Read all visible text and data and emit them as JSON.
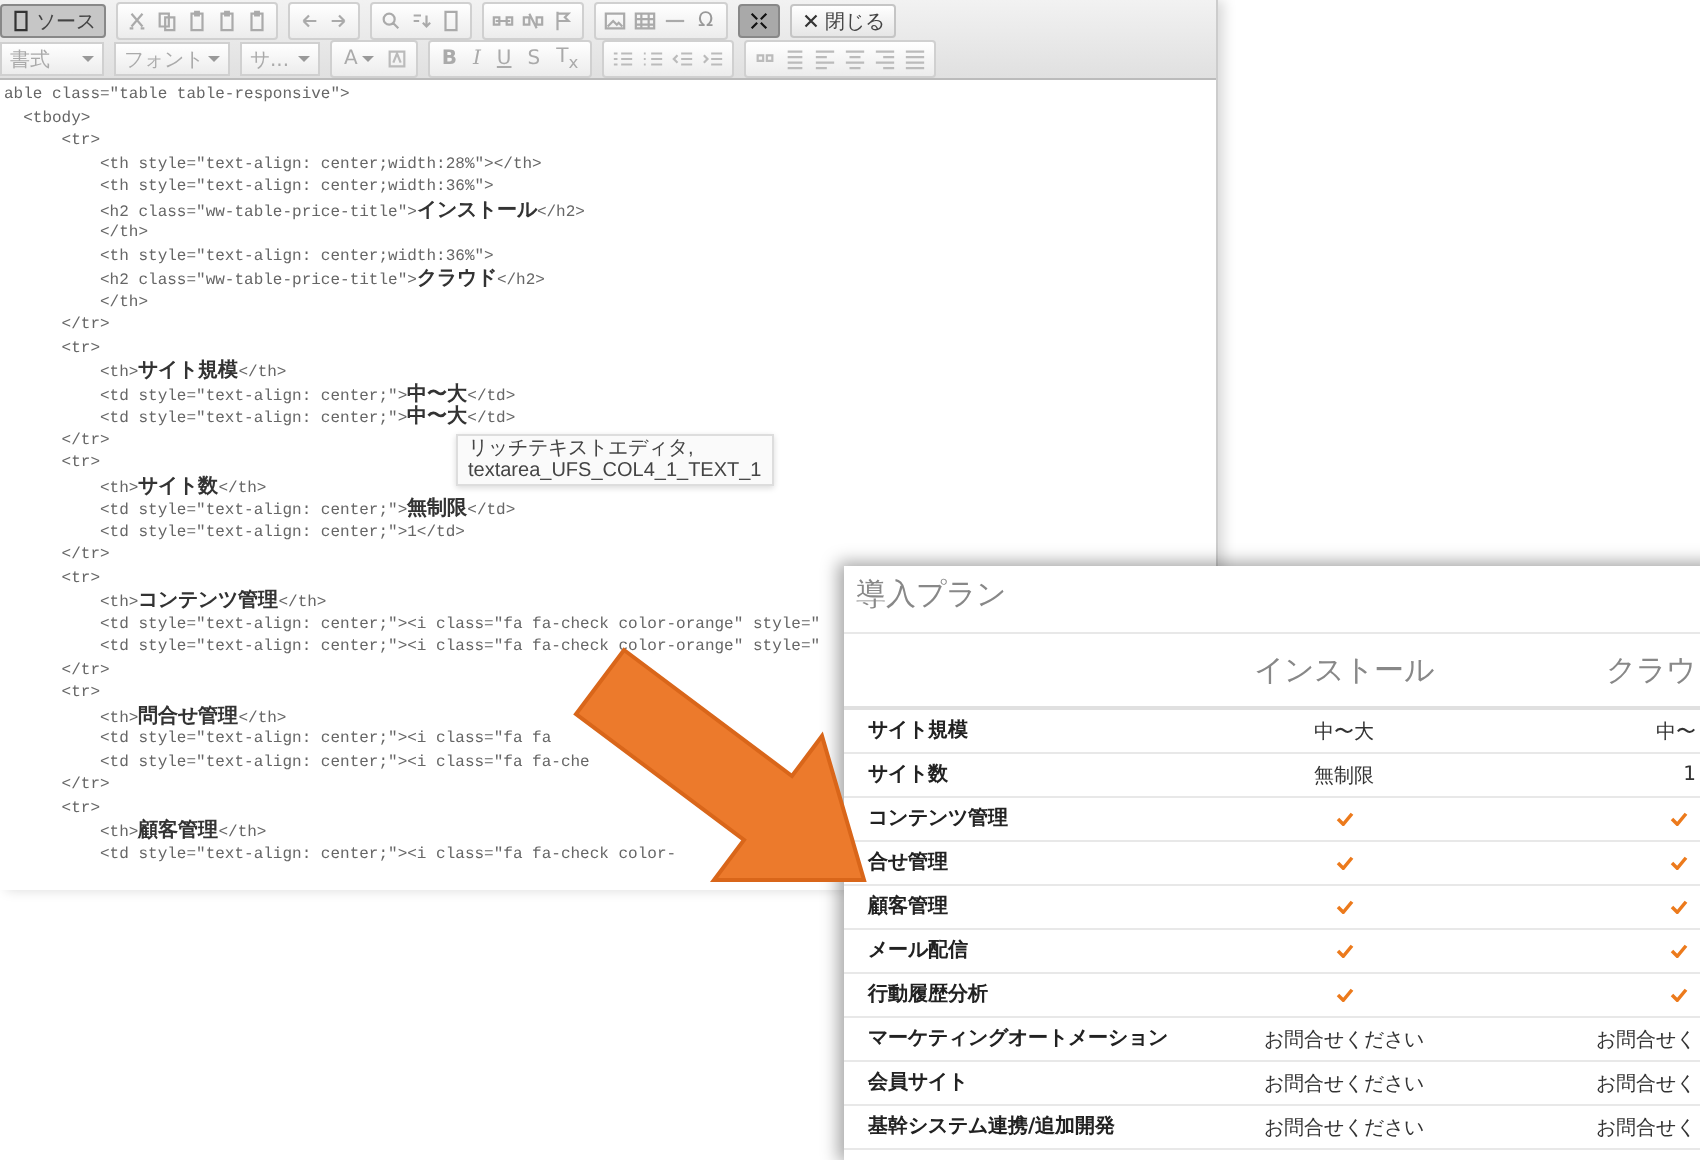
{
  "toolbar": {
    "source_button": {
      "label": "ソース",
      "selected": true
    },
    "special_char_label": "Ω",
    "maximize_button": {
      "selected": true
    },
    "close_button": {
      "label": "閉じる"
    },
    "format_bar": {
      "disabled": true,
      "format_dropdown": "書式",
      "font_dropdown": "フォント",
      "size_dropdown": "サ...",
      "text_color_label": "A",
      "style_buttons": [
        "B",
        "I",
        "U",
        "S",
        "T$_{x}$"
      ]
    }
  },
  "code_lines": [
    "able class=\"table table-responsive\">",
    "  <tbody>",
    "      <tr>",
    "          <th style=\"text-align: center;width:28%\"></th>",
    "          <th style=\"text-align: center;width:36%\">",
    "          <h2 class=\"ww-table-price-title\">**インストール**</h2>",
    "          </th>",
    "          <th style=\"text-align: center;width:36%\">",
    "          <h2 class=\"ww-table-price-title\">**クラウド**</h2>",
    "          </th>",
    "      </tr>",
    "      <tr>",
    "          <th>**サイト規模**</th>",
    "          <td style=\"text-align: center;\">**中〜大**</td>",
    "          <td style=\"text-align: center;\">**中〜大**</td>",
    "      </tr>",
    "      <tr>",
    "          <th>**サイト数**</th>",
    "          <td style=\"text-align: center;\">**無制限**</td>",
    "          <td style=\"text-align: center;\">1</td>",
    "      </tr>",
    "      <tr>",
    "          <th>**コンテンツ管理**</th>",
    "          <td style=\"text-align: center;\"><i class=\"fa fa-check color-orange\" style=\"",
    "          <td style=\"text-align: center;\"><i class=\"fa fa-check color-orange\" style=\"",
    "      </tr>",
    "      <tr>",
    "          <th>**問合せ管理**</th>",
    "          <td style=\"text-align: center;\"><i class=\"fa fa",
    "          <td style=\"text-align: center;\"><i class=\"fa fa-che",
    "      </tr>",
    "      <tr>",
    "          <th>**顧客管理**</th>",
    "          <td style=\"text-align: center;\"><i class=\"fa fa-check color-"
  ],
  "tooltip": {
    "lines": [
      "リッチテキストエディタ,",
      "textarea_UFS_COL4_1_TEXT_1"
    ]
  },
  "price_table": {
    "title": "導入プラン",
    "columns": [
      "インストール",
      "クラウ"
    ],
    "rows": [
      {
        "label": "サイト規模",
        "cells": [
          {
            "kind": "text",
            "text": "中〜大"
          },
          {
            "kind": "text",
            "text": "中〜"
          }
        ]
      },
      {
        "label": "サイト数",
        "cells": [
          {
            "kind": "text",
            "text": "無制限"
          },
          {
            "kind": "text",
            "text": "1"
          }
        ]
      },
      {
        "label": "コンテンツ管理",
        "cells": [
          {
            "kind": "check"
          },
          {
            "kind": "check"
          }
        ]
      },
      {
        "label": "合せ管理",
        "cells": [
          {
            "kind": "check"
          },
          {
            "kind": "check"
          }
        ]
      },
      {
        "label": "顧客管理",
        "cells": [
          {
            "kind": "check"
          },
          {
            "kind": "check"
          }
        ]
      },
      {
        "label": "メール配信",
        "cells": [
          {
            "kind": "check"
          },
          {
            "kind": "check"
          }
        ]
      },
      {
        "label": "行動履歴分析",
        "cells": [
          {
            "kind": "check"
          },
          {
            "kind": "check"
          }
        ]
      },
      {
        "label": "マーケティングオートメーション",
        "cells": [
          {
            "kind": "text",
            "text": "お問合せください"
          },
          {
            "kind": "text",
            "text": "お問合せく"
          }
        ]
      },
      {
        "label": "会員サイト",
        "cells": [
          {
            "kind": "text",
            "text": "お問合せください"
          },
          {
            "kind": "text",
            "text": "お問合せく"
          }
        ]
      },
      {
        "label": "基幹システム連携/追加開発",
        "cells": [
          {
            "kind": "text",
            "text": "お問合せください"
          },
          {
            "kind": "text",
            "text": "お問合せく"
          }
        ]
      }
    ]
  }
}
